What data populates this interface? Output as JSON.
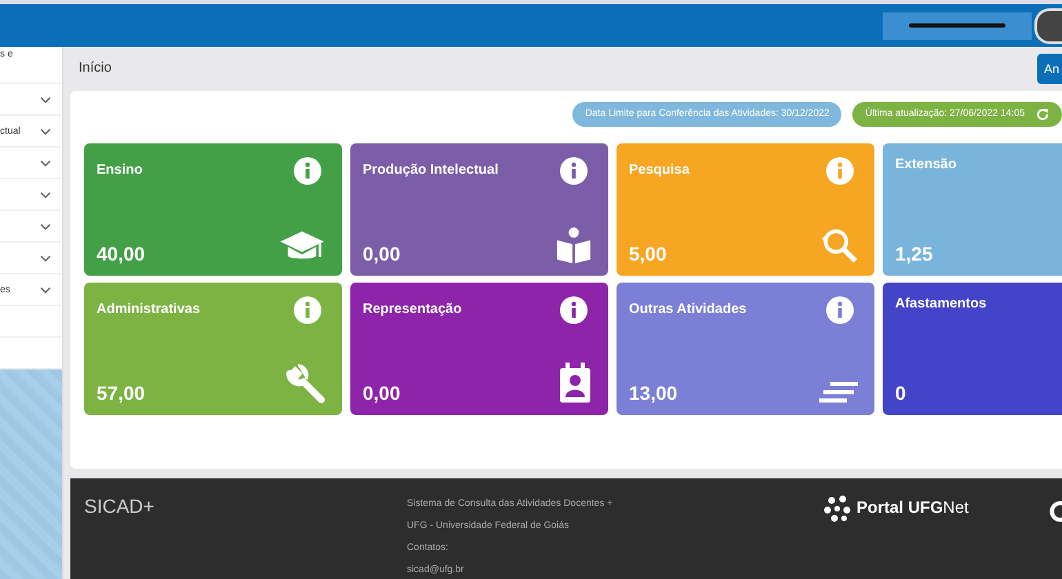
{
  "header": {
    "user_redacted": true
  },
  "sidebar": {
    "items": [
      {
        "label": "s e",
        "chevron": false
      },
      {
        "chevron": true
      },
      {
        "label": "ctual",
        "chevron": true
      },
      {
        "chevron": true
      },
      {
        "chevron": true
      },
      {
        "chevron": true
      },
      {
        "chevron": true
      },
      {
        "label": "es",
        "chevron": true
      },
      {
        "chevron": false
      },
      {
        "chevron": false
      }
    ]
  },
  "page": {
    "title": "Início",
    "button": "An"
  },
  "badges": [
    {
      "text": "Data Limite para Conferência das Atividades: 30/12/2022",
      "color": "#7fb8dc",
      "refresh": false
    },
    {
      "text": "Última atualização: 27/06/2022 14:05",
      "color": "#7cb342",
      "refresh": true
    }
  ],
  "tiles": [
    {
      "title": "Ensino",
      "value": "40,00",
      "color": "#43a047",
      "info": true
    },
    {
      "title": "Produção Intelectual",
      "value": "0,00",
      "color": "#7b5ea7",
      "info": true
    },
    {
      "title": "Pesquisa",
      "value": "5,00",
      "color": "#f6a623",
      "info": true
    },
    {
      "title": "Extensão",
      "value": "1,25",
      "color": "#79b4dc",
      "info": false
    },
    {
      "title": "Administrativas",
      "value": "57,00",
      "color": "#7cb342",
      "info": true
    },
    {
      "title": "Representação",
      "value": "0,00",
      "color": "#8e24aa",
      "info": true
    },
    {
      "title": "Outras Atividades",
      "value": "13,00",
      "color": "#7b7fd6",
      "info": true
    },
    {
      "title": "Afastamentos",
      "value": "0",
      "color": "#4444c8",
      "info": false
    }
  ],
  "footer": {
    "brand": "SICAD+",
    "lines": [
      "Sistema de Consulta das Atividades Docentes +",
      "UFG - Universidade Federal de Goiás",
      "Contatos:",
      "sicad@ufg.br"
    ],
    "logo": "**Portal UFG**Net"
  }
}
